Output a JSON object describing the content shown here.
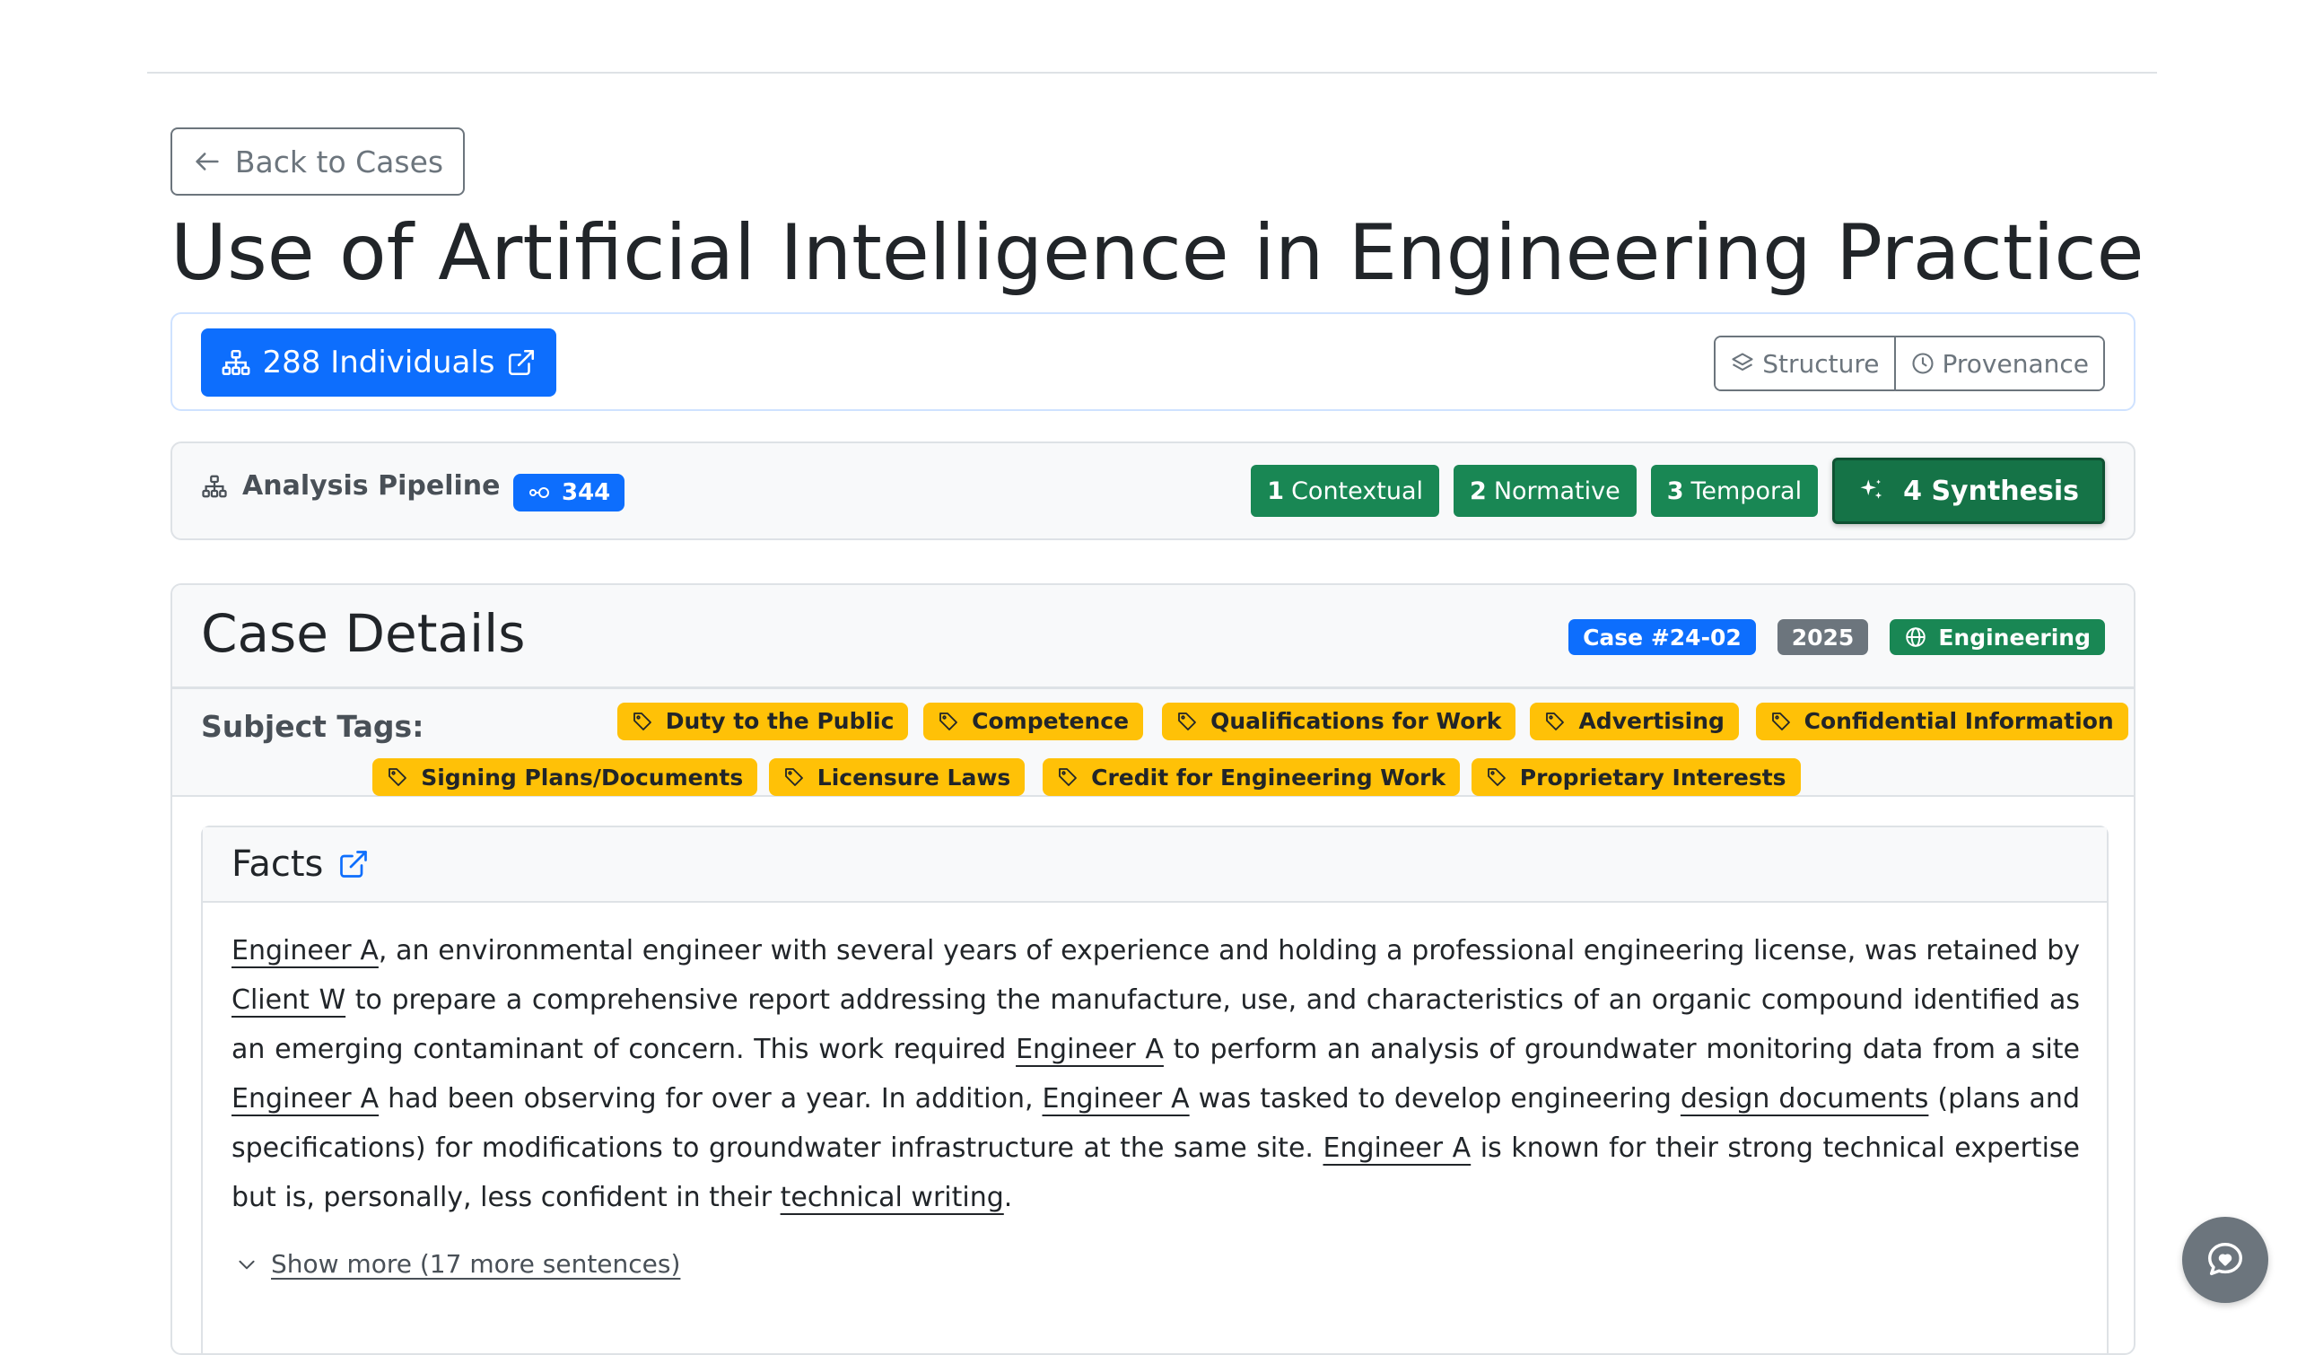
{
  "nav": {
    "back_label": "Back to Cases"
  },
  "page": {
    "title": "Use of Artificial Intelligence in Engineering Practice"
  },
  "individuals": {
    "button_label": "288 Individuals",
    "structure_label": "Structure",
    "provenance_label": "Provenance"
  },
  "pipeline": {
    "label": "Analysis Pipeline",
    "count": "344",
    "steps": [
      {
        "num": "1",
        "label": "Contextual"
      },
      {
        "num": "2",
        "label": "Normative"
      },
      {
        "num": "3",
        "label": "Temporal"
      },
      {
        "num": "4",
        "label": "Synthesis"
      }
    ]
  },
  "case": {
    "header": "Case Details",
    "case_number": "Case #24-02",
    "year": "2025",
    "category": "Engineering",
    "subject_tags_label": "Subject Tags:",
    "tags": [
      "Duty to the Public",
      "Competence",
      "Qualifications for Work",
      "Advertising",
      "Confidential Information",
      "Signing Plans/Documents",
      "Licensure Laws",
      "Credit for Engineering Work",
      "Proprietary Interests"
    ]
  },
  "facts": {
    "title": "Facts",
    "segments": [
      "Engineer A",
      ", an environmental engineer with several years of experience and holding a professional engineering license, was retained by ",
      "Client W",
      " to prepare a comprehensive report addressing the manufacture, use, and characteristics of an organic compound identified as an emerging contaminant of concern. This work required ",
      "Engineer A",
      " to perform an analysis of groundwater monitoring data from a site ",
      "Engineer A",
      " had been observing for over a year. In addition, ",
      "Engineer A",
      " was tasked to develop engineering ",
      "design documents",
      " (plans and specifications) for modifications to groundwater infrastructure at the same site. ",
      "Engineer A",
      " is known for their strong technical expertise but is, personally, less confident in their ",
      "technical writing",
      "."
    ],
    "show_more": "Show more (17 more sentences)"
  },
  "colors": {
    "primary": "#0d6efd",
    "success": "#198754",
    "warning": "#ffc107",
    "secondary": "#6c757d"
  }
}
